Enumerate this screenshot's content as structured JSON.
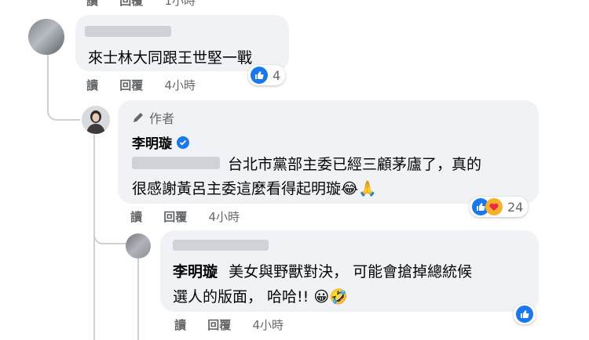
{
  "top_partial": {
    "reply": "讀",
    "reply2": "回覆",
    "time": "1小時"
  },
  "comment1": {
    "text": "來士林大同跟王世堅一戰",
    "actions": {
      "reply": "讀",
      "reply2": "回覆",
      "time": "4小時"
    },
    "reaction_count": "4"
  },
  "comment2": {
    "author_badge": "作者",
    "author": "李明璇",
    "text_line1": "台北市黨部主委已經三顧茅廬了，真的",
    "text_line2": "很感謝黃呂主委這麼看得起明璇😂🙏",
    "actions": {
      "reply": "讀",
      "reply2": "回覆",
      "time": "4小時"
    },
    "reaction_count": "24"
  },
  "comment3": {
    "author": "李明璇",
    "text_line1": "美女與野獸對決， 可能會搶掉總統候",
    "text_line2": "選人的版面， 哈哈!! 😀🤣",
    "actions": {
      "reply": "讀",
      "reply2": "回覆",
      "time": "4小時"
    }
  },
  "colors": {
    "like_blue": "#1877f2",
    "verified_blue": "#1877f2",
    "bubble": "#f0f2f5",
    "meta_gray": "#65676b"
  }
}
